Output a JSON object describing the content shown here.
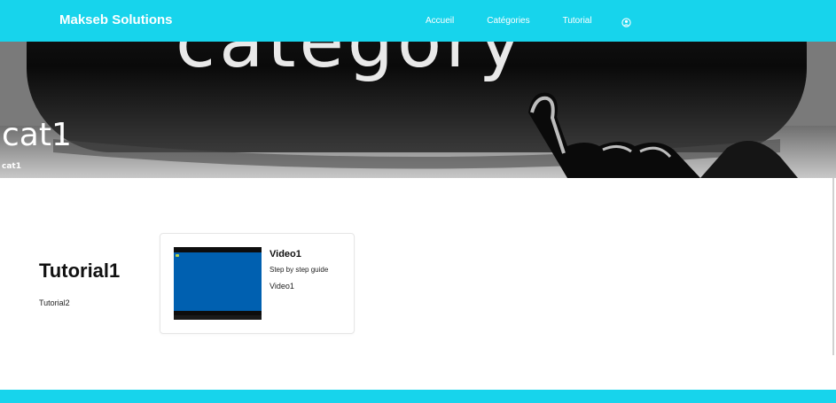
{
  "navbar": {
    "brand": "Makseb Solutions",
    "links": [
      "Accueil",
      "Catégories",
      "Tutorial"
    ],
    "user_icon": "user-circle-icon"
  },
  "hero": {
    "title": "cat1",
    "subtitle": "cat1",
    "background_word": "category"
  },
  "tutorials": {
    "items": [
      "Tutorial1",
      "Tutorial2"
    ]
  },
  "video_card": {
    "title": "Video1",
    "description": "Step by step guide",
    "name": "Video1"
  },
  "colors": {
    "accent": "#17d4ec",
    "thumbnail_blue": "#0060b0"
  }
}
